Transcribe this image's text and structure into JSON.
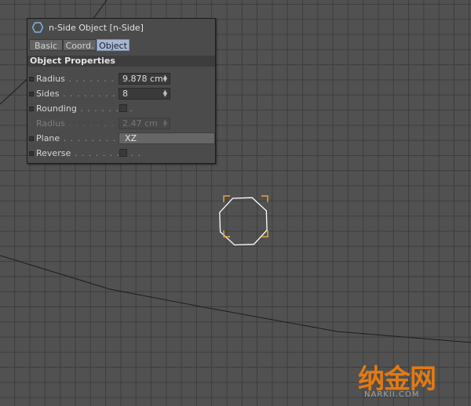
{
  "panel": {
    "title": "n-Side Object [n-Side]",
    "icon": "hexagon-icon",
    "tabs": [
      {
        "label": "Basic",
        "active": false
      },
      {
        "label": "Coord.",
        "active": false
      },
      {
        "label": "Object",
        "active": true
      }
    ],
    "section_title": "Object Properties",
    "rows": [
      {
        "label": "Radius",
        "dots": " . . . . . . . . . . .",
        "value": "9.878 cm",
        "kind": "number",
        "enabled": true
      },
      {
        "label": "Sides",
        "dots": " . . . . . . . . . . . . .",
        "value": "8",
        "kind": "number",
        "enabled": true
      },
      {
        "label": "Rounding",
        "dots": " . . . . . . . .",
        "value": "",
        "kind": "checkbox",
        "checked": false,
        "enabled": true
      },
      {
        "label": "Radius",
        "dots": " . . . . . . . . . . .",
        "value": "2.47 cm",
        "kind": "number",
        "enabled": false
      },
      {
        "label": "Plane",
        "dots": " . . . . . . . . . . . .",
        "value": "XZ",
        "kind": "dropdown",
        "enabled": true
      },
      {
        "label": "Reverse",
        "dots": " . . . . . . . . . .",
        "value": "",
        "kind": "checkbox",
        "checked": false,
        "enabled": true
      }
    ]
  },
  "viewport": {
    "selection_color": "#e8a33a",
    "grid_color": "#3d3d3d",
    "background_color": "#515151"
  },
  "watermark": {
    "text": "纳金网",
    "subtext": "NARKII.COM",
    "color": "#e37a12"
  }
}
